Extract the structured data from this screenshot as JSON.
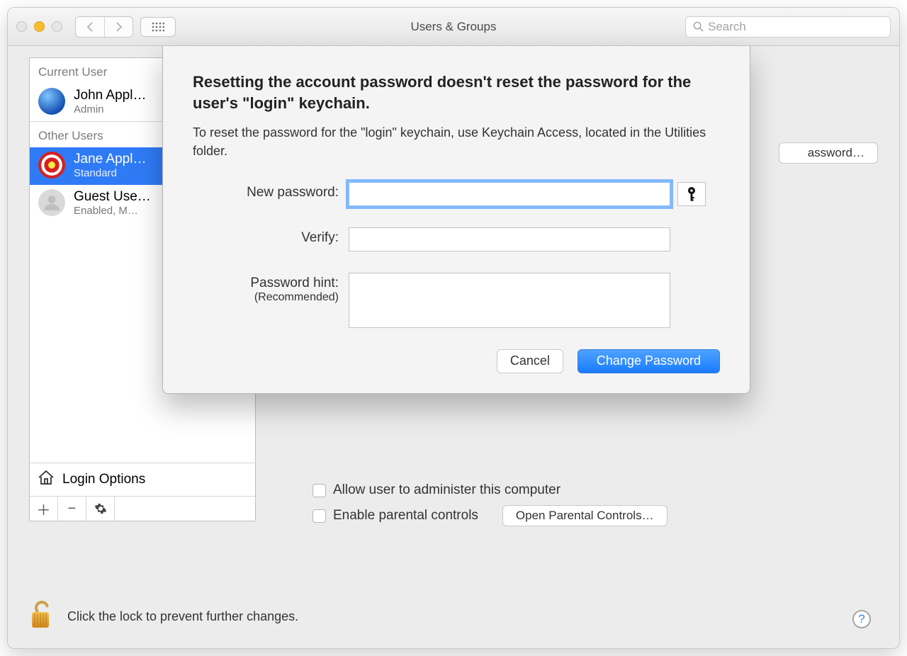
{
  "window": {
    "title": "Users & Groups"
  },
  "search": {
    "placeholder": "Search"
  },
  "sidebar": {
    "current_header": "Current User",
    "other_header": "Other Users",
    "current": {
      "name": "John Appl…",
      "role": "Admin"
    },
    "others": [
      {
        "name": "Jane Appl…",
        "role": "Standard"
      },
      {
        "name": "Guest Use…",
        "role": "Enabled, M…"
      }
    ],
    "login_options": "Login Options"
  },
  "pane": {
    "reset_password_btn": "assword…",
    "admin_checkbox": "Allow user to administer this computer",
    "parental_checkbox": "Enable parental controls",
    "parental_btn": "Open Parental Controls…"
  },
  "footer": {
    "lock_text": "Click the lock to prevent further changes.",
    "help": "?"
  },
  "sheet": {
    "heading": "Resetting the account password doesn't reset the password for the user's \"login\" keychain.",
    "subtext": "To reset the password for the \"login\" keychain, use Keychain Access, located in the Utilities folder.",
    "labels": {
      "new_password": "New password:",
      "verify": "Verify:",
      "hint": "Password hint:",
      "hint_sub": "(Recommended)"
    },
    "values": {
      "new_password": "",
      "verify": "",
      "hint": ""
    },
    "buttons": {
      "cancel": "Cancel",
      "change": "Change Password"
    }
  },
  "tools": {
    "plus": "＋",
    "minus": "−",
    "gear": "✻"
  }
}
